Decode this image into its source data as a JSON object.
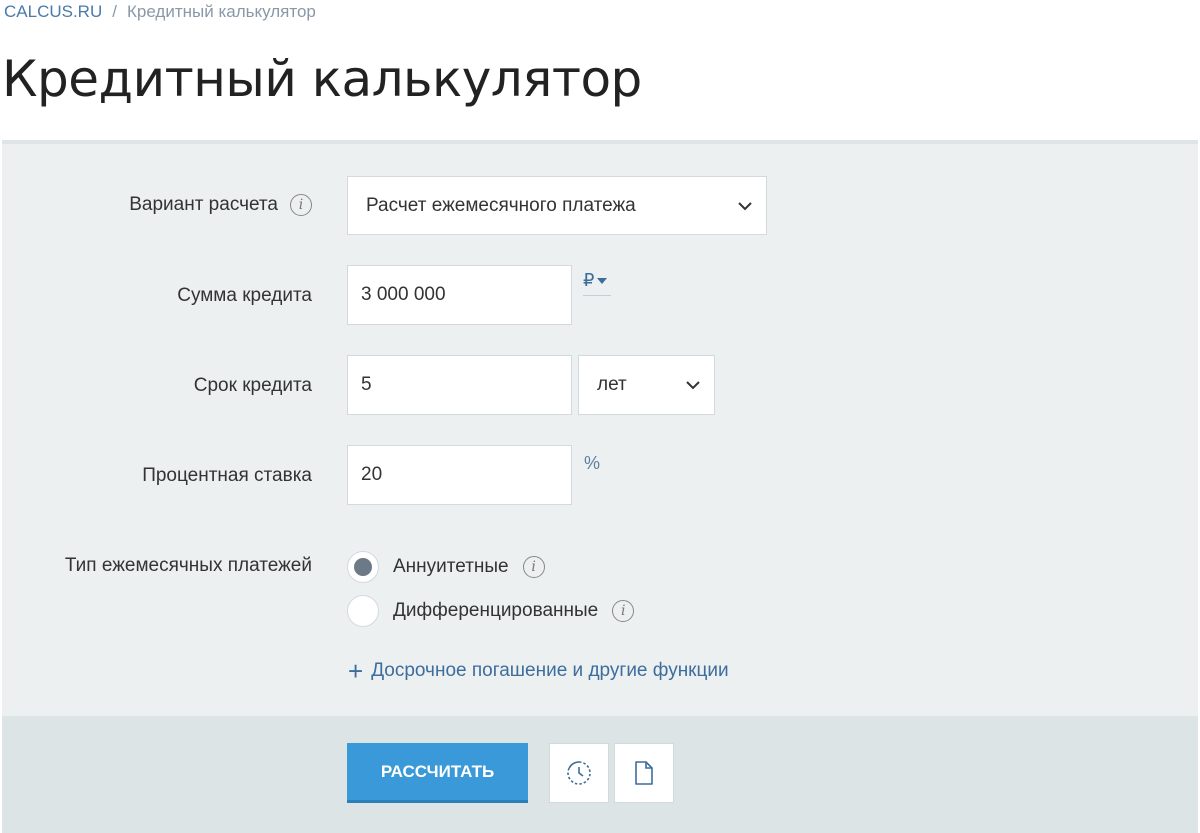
{
  "breadcrumb": {
    "home": "CALCUS.RU",
    "separator": "/",
    "current": "Кредитный калькулятор"
  },
  "page_title": "Кредитный калькулятор",
  "form": {
    "calc_variant": {
      "label": "Вариант расчета",
      "value": "Расчет ежемесячного платежа"
    },
    "loan_amount": {
      "label": "Сумма кредита",
      "value": "3 000 000",
      "currency": "₽"
    },
    "loan_term": {
      "label": "Срок кредита",
      "value": "5",
      "unit": "лет"
    },
    "interest_rate": {
      "label": "Процентная ставка",
      "value": "20",
      "unit": "%"
    },
    "payment_type": {
      "label": "Тип ежемесячных платежей",
      "options": [
        {
          "label": "Аннуитетные",
          "selected": true
        },
        {
          "label": "Дифференцированные",
          "selected": false
        }
      ]
    },
    "extra_link": "Досрочное погашение и другие функции"
  },
  "actions": {
    "calculate_label": "РАССЧИТАТЬ"
  },
  "icons": {
    "info": "info-icon",
    "history": "history-icon",
    "document": "document-icon",
    "chevron": "chevron-down-icon"
  },
  "colors": {
    "accent": "#3a9ad9",
    "link": "#3d6d9c",
    "panel_bg": "#ecf0f1",
    "footer_bg": "#dde4e6"
  }
}
